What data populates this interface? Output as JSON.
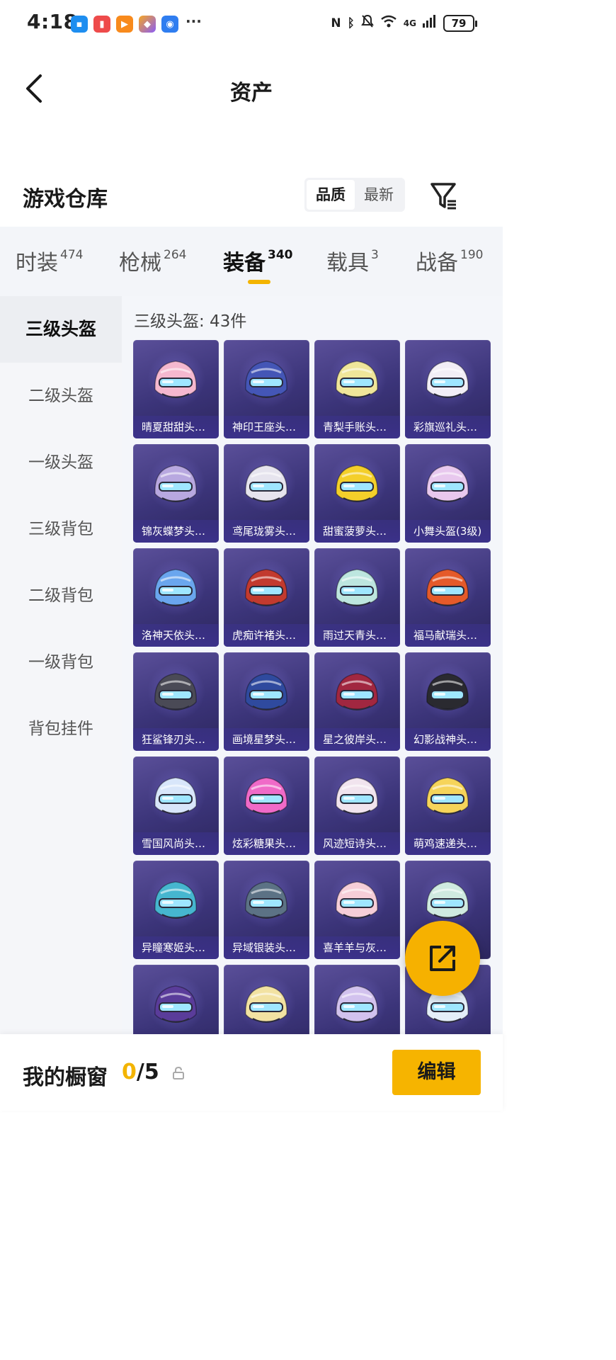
{
  "status_bar": {
    "time": "4:18",
    "dots": "···",
    "icons": [
      "nfc-icon",
      "bluetooth-icon",
      "mute-icon",
      "wifi-icon",
      "signal-icon"
    ],
    "network": "4G",
    "battery": "79"
  },
  "header": {
    "title": "资产"
  },
  "warehouse": {
    "title": "游戏仓库",
    "sort_quality": "品质",
    "sort_latest": "最新"
  },
  "tabs": [
    {
      "label": "时装",
      "count": "474"
    },
    {
      "label": "枪械",
      "count": "264"
    },
    {
      "label": "装备",
      "count": "340"
    },
    {
      "label": "载具",
      "count": "3"
    },
    {
      "label": "战备",
      "count": "190"
    }
  ],
  "sidebar": {
    "items": [
      "三级头盔",
      "二级头盔",
      "一级头盔",
      "三级背包",
      "二级背包",
      "一级背包",
      "背包挂件"
    ]
  },
  "content": {
    "count_label": "三级头盔: 43件",
    "items": [
      {
        "label": "晴夏甜甜头…",
        "color": "#f5b8cf"
      },
      {
        "label": "神印王座头…",
        "color": "#4456b6"
      },
      {
        "label": "青梨手账头…",
        "color": "#f0e69a"
      },
      {
        "label": "彩旗巡礼头…",
        "color": "#f2eef6"
      },
      {
        "label": "锦灰蝶梦头…",
        "color": "#b8a8e0"
      },
      {
        "label": "鸢尾珑雾头…",
        "color": "#e6e4ee"
      },
      {
        "label": "甜蜜菠萝头…",
        "color": "#f4cf2a"
      },
      {
        "label": "小舞头盔(3级)",
        "color": "#e8c8ee"
      },
      {
        "label": "洛神天依头…",
        "color": "#6aa6ee"
      },
      {
        "label": "虎痴许褚头…",
        "color": "#c23a2e"
      },
      {
        "label": "雨过天青头…",
        "color": "#bde6df"
      },
      {
        "label": "福马献瑞头…",
        "color": "#e55a2a"
      },
      {
        "label": "狂鲨锋刃头…",
        "color": "#4a4a56"
      },
      {
        "label": "画境星梦头…",
        "color": "#2f4a9e"
      },
      {
        "label": "星之彼岸头…",
        "color": "#a12740"
      },
      {
        "label": "幻影战神头…",
        "color": "#2a2a30"
      },
      {
        "label": "雪国风尚头…",
        "color": "#d8e6fa"
      },
      {
        "label": "炫彩糖果头…",
        "color": "#f06ac8"
      },
      {
        "label": "风迹短诗头…",
        "color": "#f1e4ee"
      },
      {
        "label": "萌鸡速递头…",
        "color": "#f6d45a"
      },
      {
        "label": "异瞳寒姬头…",
        "color": "#46b6cf"
      },
      {
        "label": "异域银装头…",
        "color": "#5c7285"
      },
      {
        "label": "喜羊羊与灰…",
        "color": "#f6ced8"
      },
      {
        "label": "",
        "color": "#cfeae0"
      },
      {
        "label": "",
        "color": "#5a3c9a"
      },
      {
        "label": "",
        "color": "#f2e2a2"
      },
      {
        "label": "",
        "color": "#d2c2ee"
      },
      {
        "label": "",
        "color": "#e4eef8"
      }
    ]
  },
  "bottom_bar": {
    "showcase_label": "我的橱窗",
    "used": "0",
    "separator_total": "/5",
    "edit_label": "编辑"
  },
  "colors": {
    "accent": "#f3b400",
    "card_bg": "#3b3479"
  }
}
